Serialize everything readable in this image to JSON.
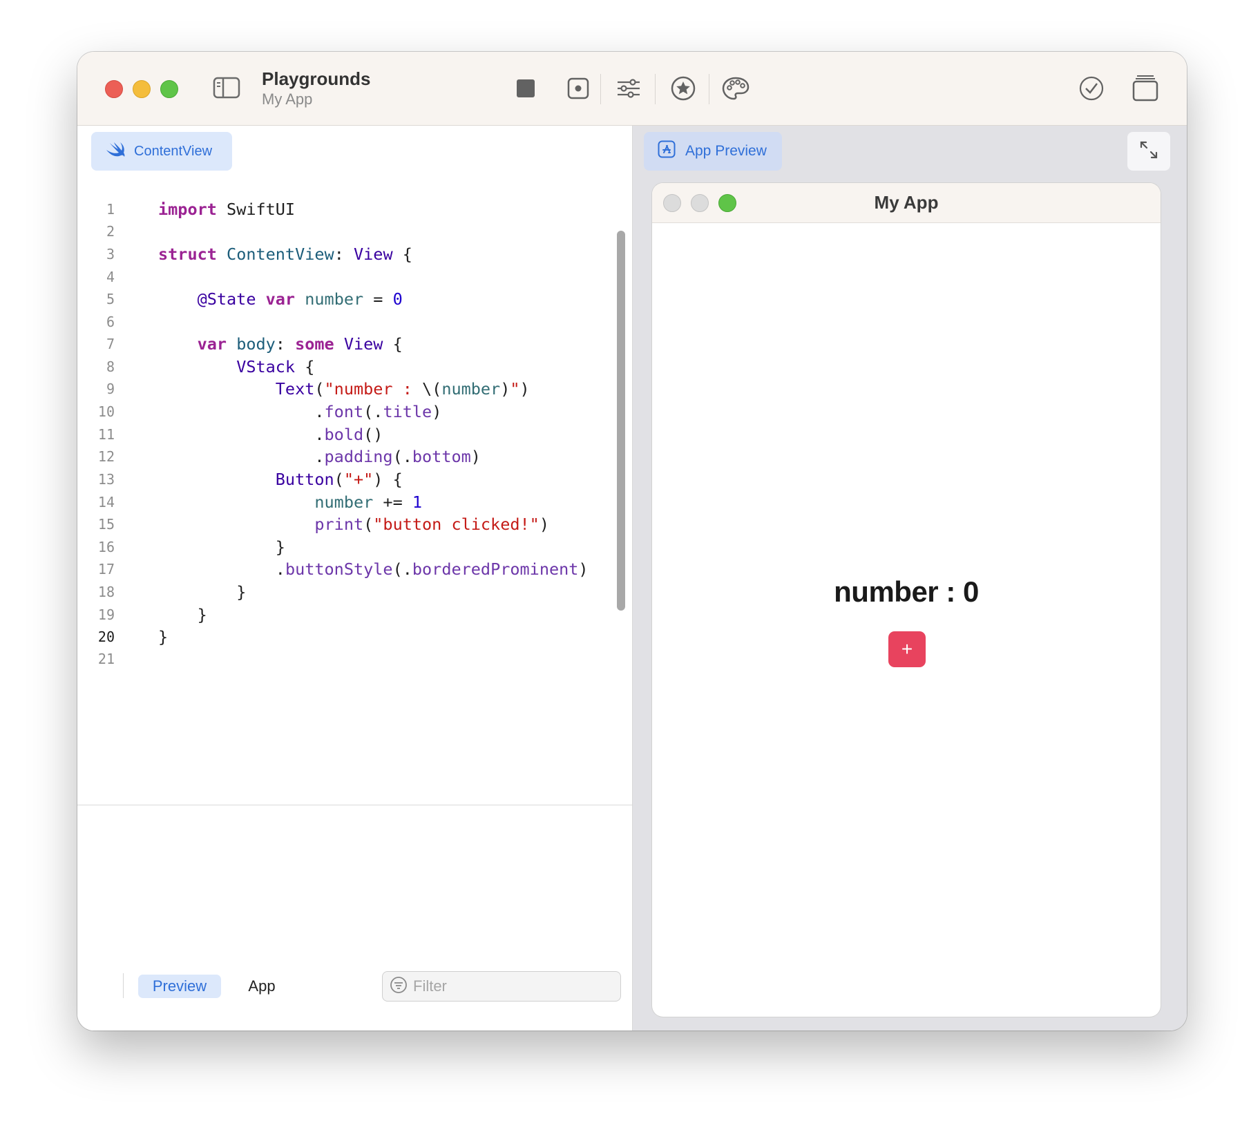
{
  "titlebar": {
    "title": "Playgrounds",
    "subtitle": "My App"
  },
  "toolbar_icons": [
    "sidebar-toggle-icon",
    "stop-icon",
    "record-icon",
    "sliders-icon",
    "star-icon",
    "palette-icon",
    "checkmark-icon",
    "windows-icon"
  ],
  "editor": {
    "file_tab": "ContentView",
    "current_line": 20,
    "lines": [
      {
        "n": "1"
      },
      {
        "n": "2"
      },
      {
        "n": "3"
      },
      {
        "n": "4"
      },
      {
        "n": "5"
      },
      {
        "n": "6"
      },
      {
        "n": "7"
      },
      {
        "n": "8"
      },
      {
        "n": "9"
      },
      {
        "n": "10"
      },
      {
        "n": "11"
      },
      {
        "n": "12"
      },
      {
        "n": "13"
      },
      {
        "n": "14"
      },
      {
        "n": "15"
      },
      {
        "n": "16"
      },
      {
        "n": "17"
      },
      {
        "n": "18"
      },
      {
        "n": "19"
      },
      {
        "n": "20"
      },
      {
        "n": "21"
      }
    ],
    "code_text": [
      "import SwiftUI",
      "",
      "struct ContentView: View {",
      "",
      "    @State var number = 0",
      "",
      "    var body: some View {",
      "        VStack {",
      "            Text(\"number : \\(number)\")",
      "                .font(.title)",
      "                .bold()",
      "                .padding(.bottom)",
      "            Button(\"+\") {",
      "                number += 1",
      "                print(\"button clicked!\")",
      "            }",
      "            .buttonStyle(.borderedProminent)",
      "        }",
      "    }",
      "}",
      ""
    ]
  },
  "bottom_bar": {
    "segment_preview": "Preview",
    "segment_app": "App",
    "filter_placeholder": "Filter"
  },
  "preview": {
    "tab_label": "App Preview",
    "window_title": "My App",
    "number_text": "number : 0",
    "button_label": "+"
  },
  "colors": {
    "accent": "#2f6fd8",
    "button": "#e8435e",
    "keyword": "#9b2393",
    "string": "#c41a16",
    "number": "#1c00cf"
  }
}
